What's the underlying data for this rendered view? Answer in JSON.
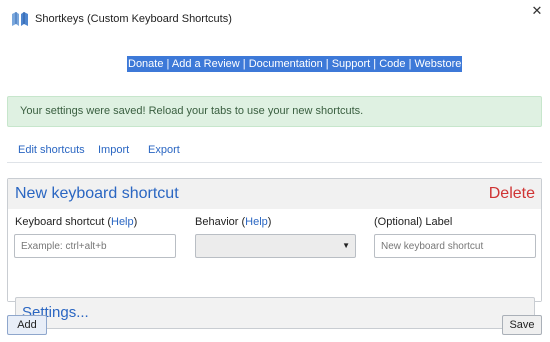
{
  "window": {
    "title": "Shortkeys (Custom Keyboard Shortcuts)",
    "close_glyph": "✕"
  },
  "links": [
    {
      "label": "Donate"
    },
    {
      "label": "Add a Review"
    },
    {
      "label": "Documentation"
    },
    {
      "label": "Support"
    },
    {
      "label": "Code"
    },
    {
      "label": "Webstore"
    }
  ],
  "link_separator": " | ",
  "alert": {
    "message": "Your settings were saved! Reload your tabs to use your new shortcuts."
  },
  "tabs": [
    {
      "label": "Edit shortcuts"
    },
    {
      "label": "Import"
    },
    {
      "label": "Export"
    }
  ],
  "shortcut_panel": {
    "title": "New keyboard shortcut",
    "delete_label": "Delete",
    "keyboard_shortcut": {
      "label": "Keyboard shortcut (",
      "help": "Help",
      "label_end": ")",
      "value": "",
      "placeholder": "Example: ctrl+alt+b"
    },
    "behavior": {
      "label": "Behavior (",
      "help": "Help",
      "label_end": ")",
      "selected": ""
    },
    "optional_label": {
      "label": "(Optional) Label",
      "value": "",
      "placeholder": "New keyboard shortcut"
    },
    "settings_label": "Settings..."
  },
  "buttons": {
    "add": "Add",
    "save": "Save"
  },
  "colors": {
    "accent": "#2a66c2",
    "delete": "#cf3434",
    "alert_bg": "#dff1e2",
    "links_highlight": "#3d79d8"
  },
  "icons": {
    "app": "shortkeys-app-icon",
    "close": "close-icon",
    "dropdown": "chevron-down-icon"
  }
}
